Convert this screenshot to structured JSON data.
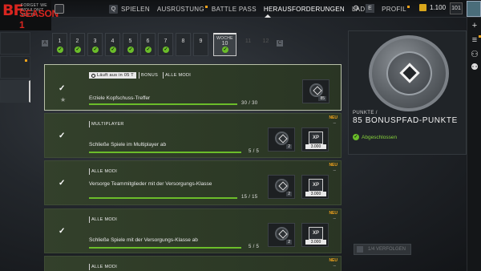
{
  "logo": {
    "short": "BF",
    "small_text": "FORGET WE WOULDN'T SEE IN",
    "season": "SEASON 1"
  },
  "nav": {
    "prev_key": "Q",
    "next_key": "E",
    "items": [
      {
        "label": "SPIELEN",
        "active": false,
        "dot": false
      },
      {
        "label": "AUSRÜSTUNG",
        "active": false,
        "dot": true
      },
      {
        "label": "BATTLE PASS",
        "active": false,
        "dot": false
      },
      {
        "label": "HERAUSFORDERUNGEN",
        "active": true,
        "dot": false
      },
      {
        "label": "LADEN",
        "active": false,
        "dot": false
      },
      {
        "label": "PROFIL",
        "active": false,
        "dot": true
      }
    ]
  },
  "currency": {
    "amount": "1.100"
  },
  "player": {
    "level": "101"
  },
  "weeks": {
    "prev_key": "A",
    "next_key": "C",
    "current_label": "WOCHE",
    "items": [
      {
        "num": "1",
        "done": true
      },
      {
        "num": "2",
        "done": true
      },
      {
        "num": "3",
        "done": true
      },
      {
        "num": "4",
        "done": true
      },
      {
        "num": "5",
        "done": true
      },
      {
        "num": "6",
        "done": true
      },
      {
        "num": "7",
        "done": true
      },
      {
        "num": "8",
        "done": false
      },
      {
        "num": "9",
        "done": false
      },
      {
        "num": "10",
        "done": true,
        "current": true
      },
      {
        "num": "11",
        "done": false,
        "locked": true
      },
      {
        "num": "12",
        "done": false,
        "locked": true
      }
    ]
  },
  "challenges": [
    {
      "timer": "Läuft aus in 05 T",
      "tags": [
        "BONUS",
        "ALLE MODI"
      ],
      "description": "Erziele Kopfschuss-Treffer",
      "progress": "30 / 30",
      "fraction": 1.0,
      "new": false,
      "rewards": [
        {
          "type": "badge",
          "value": "85"
        }
      ]
    },
    {
      "tags": [
        "MULTIPLAYER"
      ],
      "description": "Schließe Spiele im Multiplayer ab",
      "progress": "5 / 5",
      "fraction": 1.0,
      "new": true,
      "new_label": "NEU",
      "rewards": [
        {
          "type": "badge",
          "value": "2"
        },
        {
          "type": "xp",
          "value": "3.000",
          "glyph": "XP"
        }
      ]
    },
    {
      "tags": [
        "ALLE MODI"
      ],
      "description": "Versorge Teammitglieder mit der Versorgungs-Klasse",
      "progress": "15 / 15",
      "fraction": 1.0,
      "new": true,
      "new_label": "NEU",
      "rewards": [
        {
          "type": "badge",
          "value": "2"
        },
        {
          "type": "xp",
          "value": "3.000",
          "glyph": "XP"
        }
      ]
    },
    {
      "tags": [
        "ALLE MODI"
      ],
      "description": "Schließe Spiele mit der Versorgungs-Klasse ab",
      "progress": "5 / 5",
      "fraction": 1.0,
      "new": true,
      "new_label": "NEU",
      "rewards": [
        {
          "type": "badge",
          "value": "2"
        },
        {
          "type": "xp",
          "value": "3.000",
          "glyph": "XP"
        }
      ]
    },
    {
      "tags": [
        "ALLE MODI"
      ],
      "description": "",
      "progress": "",
      "new": true,
      "new_label": "NEU"
    }
  ],
  "detail": {
    "points_label": "PUNKTE /",
    "points_title": "85 BONUSPFAD-PUNKTE",
    "status": "Abgeschlossen",
    "track_button": "1/4 VERFOLGEN"
  },
  "colors": {
    "accent_green": "#6bbd2a",
    "new_orange": "#f0a21b",
    "brand_red": "#d8251f"
  }
}
